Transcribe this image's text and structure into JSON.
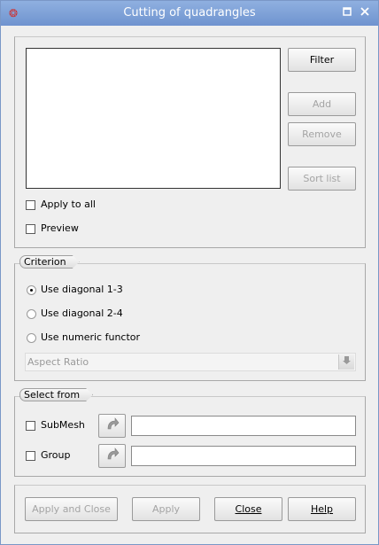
{
  "window": {
    "title": "Cutting of quadrangles"
  },
  "elements": {
    "filter_label": "Filter",
    "add_label": "Add",
    "remove_label": "Remove",
    "sort_label": "Sort list",
    "apply_to_all_label": "Apply to all",
    "preview_label": "Preview",
    "list_items": []
  },
  "criterion": {
    "title": "Criterion",
    "options": [
      "Use diagonal 1-3",
      "Use diagonal 2-4",
      "Use numeric functor"
    ],
    "selected": "Use diagonal 1-3",
    "functor_value": "Aspect Ratio"
  },
  "select_from": {
    "title": "Select from",
    "submesh_label": "SubMesh",
    "group_label": "Group",
    "submesh_value": "",
    "group_value": ""
  },
  "buttons": {
    "apply_close": "Apply and Close",
    "apply": "Apply",
    "close": "Close",
    "help": "Help"
  },
  "icons": {
    "window": "mesh-app-icon",
    "maximize": "maximize-icon",
    "close": "close-icon",
    "selection": "select-arrow-icon",
    "combo": "chevron-down-icon"
  }
}
